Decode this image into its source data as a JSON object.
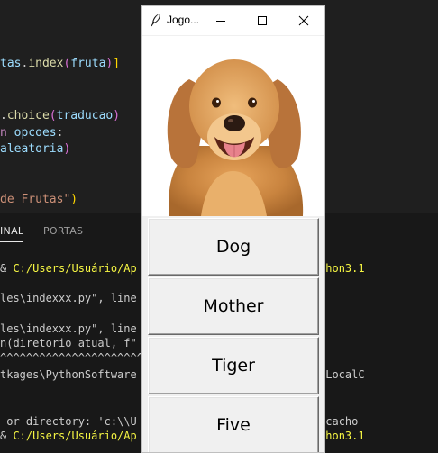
{
  "editor": {
    "lines": [
      {
        "segments": [
          {
            "t": "tas",
            "c": "#9cdcfe"
          },
          {
            "t": ".",
            "c": "#cccccc"
          },
          {
            "t": "index",
            "c": "#dcdcaa"
          },
          {
            "t": "(",
            "c": "#da70d6"
          },
          {
            "t": "fruta",
            "c": "#9cdcfe"
          },
          {
            "t": ")",
            "c": "#da70d6"
          },
          {
            "t": "]",
            "c": "#ffd700"
          }
        ]
      },
      {
        "segments": [
          {
            "t": ".",
            "c": "#cccccc"
          },
          {
            "t": "choice",
            "c": "#dcdcaa"
          },
          {
            "t": "(",
            "c": "#da70d6"
          },
          {
            "t": "traducao",
            "c": "#9cdcfe"
          },
          {
            "t": ")",
            "c": "#da70d6"
          }
        ]
      },
      {
        "segments": [
          {
            "t": "n ",
            "c": "#c586c0"
          },
          {
            "t": "opcoes",
            "c": "#9cdcfe"
          },
          {
            "t": ":",
            "c": "#cccccc"
          }
        ]
      },
      {
        "segments": [
          {
            "t": "aleatoria",
            "c": "#9cdcfe"
          },
          {
            "t": ")",
            "c": "#da70d6"
          }
        ]
      },
      {
        "segments": [
          {
            "t": "de Frutas\"",
            "c": "#ce9178"
          },
          {
            "t": ")",
            "c": "#ffd700"
          }
        ]
      }
    ]
  },
  "panel": {
    "tabs": [
      "INAL",
      "PORTAS"
    ]
  },
  "terminal": {
    "lines": [
      {
        "segments": [
          {
            "t": "& ",
            "c": "#cccccc"
          },
          {
            "t": "C:/Users/Usuário/Ap",
            "c": "#f5f543"
          },
          {
            "t": "                  ",
            "c": "#cccccc"
          },
          {
            "t": "owsApps/python3.1",
            "c": "#f5f543"
          }
        ]
      },
      {
        "segments": [
          {
            "t": "les\\indexxx.py\", line",
            "c": "#cccccc"
          }
        ]
      },
      {
        "segments": [
          {
            "t": "les\\indexxx.py\", line",
            "c": "#cccccc"
          }
        ]
      },
      {
        "segments": [
          {
            "t": "n(diretorio_atual, f\"",
            "c": "#cccccc"
          }
        ]
      },
      {
        "segments": [
          {
            "t": "^^^^^^^^^^^^^^^^^^^^^^",
            "c": "#cccccc"
          }
        ]
      },
      {
        "segments": [
          {
            "t": "tkages\\PythonSoftware",
            "c": "#cccccc"
          },
          {
            "t": "                  ",
            "c": "#cccccc"
          },
          {
            "t": "5n2kfra8p0\\LocalC",
            "c": "#cccccc"
          }
        ]
      },
      {
        "segments": [
          {
            "t": " or directory: 'c:\\\\U",
            "c": "#cccccc"
          },
          {
            "t": "                 ",
            "c": "#cccccc"
          },
          {
            "t": "go Ingles\\\\5cacho",
            "c": "#cccccc"
          }
        ]
      },
      {
        "segments": [
          {
            "t": "& ",
            "c": "#cccccc"
          },
          {
            "t": "C:/Users/Usuário/Ap",
            "c": "#f5f543"
          },
          {
            "t": "                  ",
            "c": "#cccccc"
          },
          {
            "t": "owsApps/python3.1",
            "c": "#f5f543"
          }
        ]
      }
    ]
  },
  "window": {
    "title": "Jogo...",
    "icons": {
      "app": "feather-icon",
      "minimize": "minimize-icon",
      "maximize": "maximize-icon",
      "close": "close-icon"
    },
    "image": {
      "subject": "golden-retriever-dog"
    },
    "options": [
      "Dog",
      "Mother",
      "Tiger",
      "Five"
    ]
  }
}
